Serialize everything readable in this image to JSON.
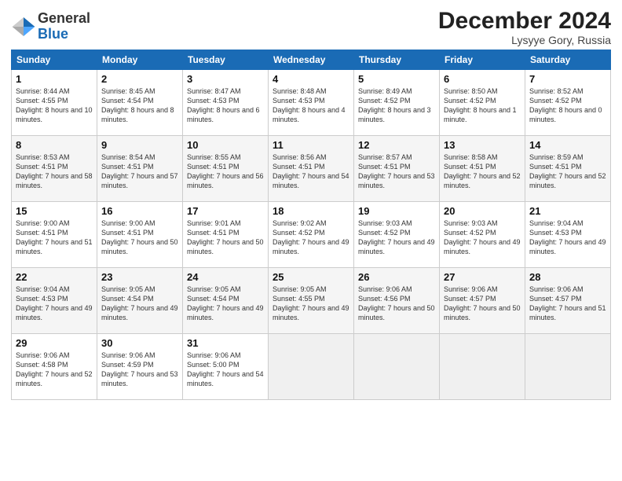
{
  "header": {
    "logo_general": "General",
    "logo_blue": "Blue",
    "month_title": "December 2024",
    "location": "Lysyye Gory, Russia"
  },
  "days_of_week": [
    "Sunday",
    "Monday",
    "Tuesday",
    "Wednesday",
    "Thursday",
    "Friday",
    "Saturday"
  ],
  "weeks": [
    [
      {
        "day": "1",
        "sunrise": "8:44 AM",
        "sunset": "4:55 PM",
        "daylight": "8 hours and 10 minutes."
      },
      {
        "day": "2",
        "sunrise": "8:45 AM",
        "sunset": "4:54 PM",
        "daylight": "8 hours and 8 minutes."
      },
      {
        "day": "3",
        "sunrise": "8:47 AM",
        "sunset": "4:53 PM",
        "daylight": "8 hours and 6 minutes."
      },
      {
        "day": "4",
        "sunrise": "8:48 AM",
        "sunset": "4:53 PM",
        "daylight": "8 hours and 4 minutes."
      },
      {
        "day": "5",
        "sunrise": "8:49 AM",
        "sunset": "4:52 PM",
        "daylight": "8 hours and 3 minutes."
      },
      {
        "day": "6",
        "sunrise": "8:50 AM",
        "sunset": "4:52 PM",
        "daylight": "8 hours and 1 minute."
      },
      {
        "day": "7",
        "sunrise": "8:52 AM",
        "sunset": "4:52 PM",
        "daylight": "8 hours and 0 minutes."
      }
    ],
    [
      {
        "day": "8",
        "sunrise": "8:53 AM",
        "sunset": "4:51 PM",
        "daylight": "7 hours and 58 minutes."
      },
      {
        "day": "9",
        "sunrise": "8:54 AM",
        "sunset": "4:51 PM",
        "daylight": "7 hours and 57 minutes."
      },
      {
        "day": "10",
        "sunrise": "8:55 AM",
        "sunset": "4:51 PM",
        "daylight": "7 hours and 56 minutes."
      },
      {
        "day": "11",
        "sunrise": "8:56 AM",
        "sunset": "4:51 PM",
        "daylight": "7 hours and 54 minutes."
      },
      {
        "day": "12",
        "sunrise": "8:57 AM",
        "sunset": "4:51 PM",
        "daylight": "7 hours and 53 minutes."
      },
      {
        "day": "13",
        "sunrise": "8:58 AM",
        "sunset": "4:51 PM",
        "daylight": "7 hours and 52 minutes."
      },
      {
        "day": "14",
        "sunrise": "8:59 AM",
        "sunset": "4:51 PM",
        "daylight": "7 hours and 52 minutes."
      }
    ],
    [
      {
        "day": "15",
        "sunrise": "9:00 AM",
        "sunset": "4:51 PM",
        "daylight": "7 hours and 51 minutes."
      },
      {
        "day": "16",
        "sunrise": "9:00 AM",
        "sunset": "4:51 PM",
        "daylight": "7 hours and 50 minutes."
      },
      {
        "day": "17",
        "sunrise": "9:01 AM",
        "sunset": "4:51 PM",
        "daylight": "7 hours and 50 minutes."
      },
      {
        "day": "18",
        "sunrise": "9:02 AM",
        "sunset": "4:52 PM",
        "daylight": "7 hours and 49 minutes."
      },
      {
        "day": "19",
        "sunrise": "9:03 AM",
        "sunset": "4:52 PM",
        "daylight": "7 hours and 49 minutes."
      },
      {
        "day": "20",
        "sunrise": "9:03 AM",
        "sunset": "4:52 PM",
        "daylight": "7 hours and 49 minutes."
      },
      {
        "day": "21",
        "sunrise": "9:04 AM",
        "sunset": "4:53 PM",
        "daylight": "7 hours and 49 minutes."
      }
    ],
    [
      {
        "day": "22",
        "sunrise": "9:04 AM",
        "sunset": "4:53 PM",
        "daylight": "7 hours and 49 minutes."
      },
      {
        "day": "23",
        "sunrise": "9:05 AM",
        "sunset": "4:54 PM",
        "daylight": "7 hours and 49 minutes."
      },
      {
        "day": "24",
        "sunrise": "9:05 AM",
        "sunset": "4:54 PM",
        "daylight": "7 hours and 49 minutes."
      },
      {
        "day": "25",
        "sunrise": "9:05 AM",
        "sunset": "4:55 PM",
        "daylight": "7 hours and 49 minutes."
      },
      {
        "day": "26",
        "sunrise": "9:06 AM",
        "sunset": "4:56 PM",
        "daylight": "7 hours and 50 minutes."
      },
      {
        "day": "27",
        "sunrise": "9:06 AM",
        "sunset": "4:57 PM",
        "daylight": "7 hours and 50 minutes."
      },
      {
        "day": "28",
        "sunrise": "9:06 AM",
        "sunset": "4:57 PM",
        "daylight": "7 hours and 51 minutes."
      }
    ],
    [
      {
        "day": "29",
        "sunrise": "9:06 AM",
        "sunset": "4:58 PM",
        "daylight": "7 hours and 52 minutes."
      },
      {
        "day": "30",
        "sunrise": "9:06 AM",
        "sunset": "4:59 PM",
        "daylight": "7 hours and 53 minutes."
      },
      {
        "day": "31",
        "sunrise": "9:06 AM",
        "sunset": "5:00 PM",
        "daylight": "7 hours and 54 minutes."
      },
      null,
      null,
      null,
      null
    ]
  ]
}
